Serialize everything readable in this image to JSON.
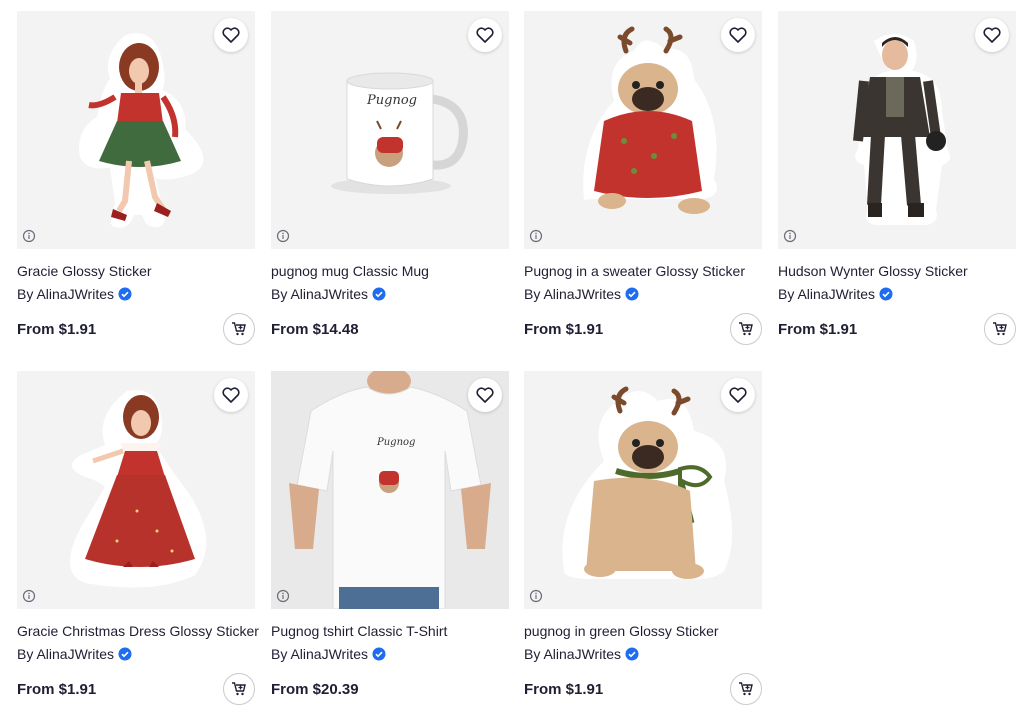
{
  "products": [
    {
      "title": "Gracie Glossy Sticker",
      "by": "By AlinaJWrites",
      "price": "From $1.91"
    },
    {
      "title": "pugnog mug Classic Mug",
      "by": "By AlinaJWrites",
      "price": "From $14.48",
      "art_text": "Pugnog"
    },
    {
      "title": "Pugnog in a sweater Glossy Sticker",
      "by": "By AlinaJWrites",
      "price": "From $1.91"
    },
    {
      "title": "Hudson Wynter Glossy Sticker",
      "by": "By AlinaJWrites",
      "price": "From $1.91"
    },
    {
      "title": "Gracie Christmas Dress Glossy Sticker",
      "by": "By AlinaJWrites",
      "price": "From $1.91"
    },
    {
      "title": "Pugnog tshirt Classic T-Shirt",
      "by": "By AlinaJWrites",
      "price": "From $20.39",
      "art_text": "Pugnog"
    },
    {
      "title": "pugnog in green Glossy Sticker",
      "by": "By AlinaJWrites",
      "price": "From $1.91"
    }
  ],
  "colors": {
    "verified": "#1e6cf0",
    "text": "#1f1f33",
    "tile_bg": "#f3f3f3"
  }
}
